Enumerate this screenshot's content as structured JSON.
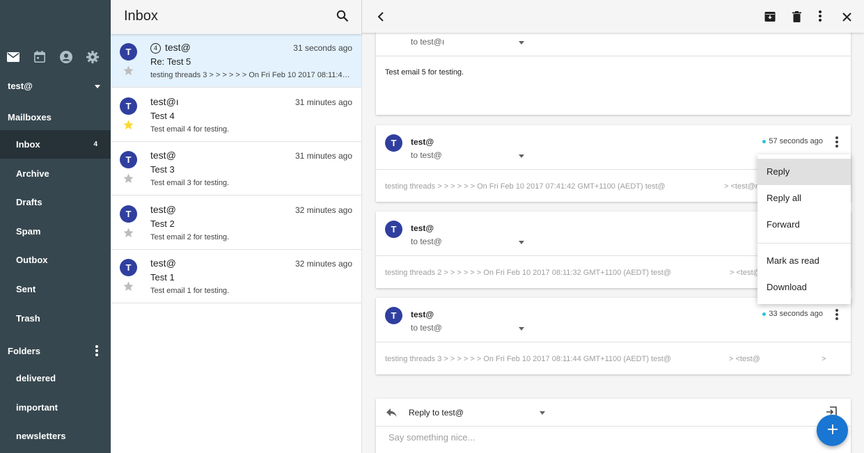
{
  "sidebar": {
    "account": "test@",
    "mailboxes_title": "Mailboxes",
    "mailboxes": [
      {
        "label": "Inbox",
        "count": "4"
      },
      {
        "label": "Archive"
      },
      {
        "label": "Drafts"
      },
      {
        "label": "Spam"
      },
      {
        "label": "Outbox"
      },
      {
        "label": "Sent"
      },
      {
        "label": "Trash"
      }
    ],
    "folders_title": "Folders",
    "folders": [
      {
        "label": "delivered"
      },
      {
        "label": "important"
      },
      {
        "label": "newsletters"
      }
    ]
  },
  "list": {
    "title": "Inbox",
    "messages": [
      {
        "avatar": "T",
        "count": "4",
        "from": "test@",
        "time": "31 seconds ago",
        "subject": "Re: Test 5",
        "preview": "testing threads 3 > > > > > > On Fri Feb 10 2017 08:11:44 ...",
        "starred": false
      },
      {
        "avatar": "T",
        "from": "test@ı",
        "time": "31 minutes ago",
        "subject": "Test 4",
        "preview": "Test email 4 for testing.",
        "starred": true
      },
      {
        "avatar": "T",
        "from": "test@",
        "time": "31 minutes ago",
        "subject": "Test 3",
        "preview": "Test email 3 for testing.",
        "starred": false
      },
      {
        "avatar": "T",
        "from": "test@",
        "time": "32 minutes ago",
        "subject": "Test 2",
        "preview": "Test email 2 for testing.",
        "starred": false
      },
      {
        "avatar": "T",
        "from": "test@",
        "time": "32 minutes ago",
        "subject": "Test 1",
        "preview": "Test email 1 for testing.",
        "starred": false
      }
    ]
  },
  "thread": {
    "card0": {
      "to": "to test@ı",
      "body": "Test email 5 for testing."
    },
    "cards": [
      {
        "avatar": "T",
        "from": "test@",
        "to": "to test@",
        "time": "57 seconds ago",
        "snippet": "testing threads > > > > > > On Fri Feb 10 2017 07:41:42 GMT+1100 (AEDT) test@",
        "tail": "> <test@n"
      },
      {
        "avatar": "T",
        "from": "test@",
        "to": "to test@",
        "time": "",
        "snippet": "testing threads 2 > > > > > > On Fri Feb 10 2017 08:11:32 GMT+1100 (AEDT) test@",
        "tail": "> <test@"
      },
      {
        "avatar": "T",
        "from": "test@",
        "to": "to test@",
        "time": "33 seconds ago",
        "snippet": "testing threads 3 > > > > > > On Fri Feb 10 2017 08:11:44 GMT+1100 (AEDT) test@",
        "tail": "> <test@",
        "tail2": ">"
      }
    ],
    "menu": [
      "Reply",
      "Reply all",
      "Forward",
      "Mark as read",
      "Download"
    ],
    "reply": {
      "to": "Reply to test@",
      "placeholder": "Say something nice..."
    }
  },
  "colors": {
    "sidebar": "#37474f",
    "sidebar_active": "#263238",
    "avatar": "#303f9f",
    "accent": "#1976d2",
    "selected_row": "#e3f2fd",
    "unread_dot": "#26c6da",
    "star": "#fdd835"
  },
  "icons": [
    "mail-icon",
    "calendar-icon",
    "contacts-icon",
    "gear-icon",
    "search-icon",
    "back-icon",
    "archive-icon",
    "trash-icon",
    "more-icon",
    "close-icon",
    "star-icon",
    "reply-icon",
    "popout-icon",
    "plus-icon"
  ]
}
